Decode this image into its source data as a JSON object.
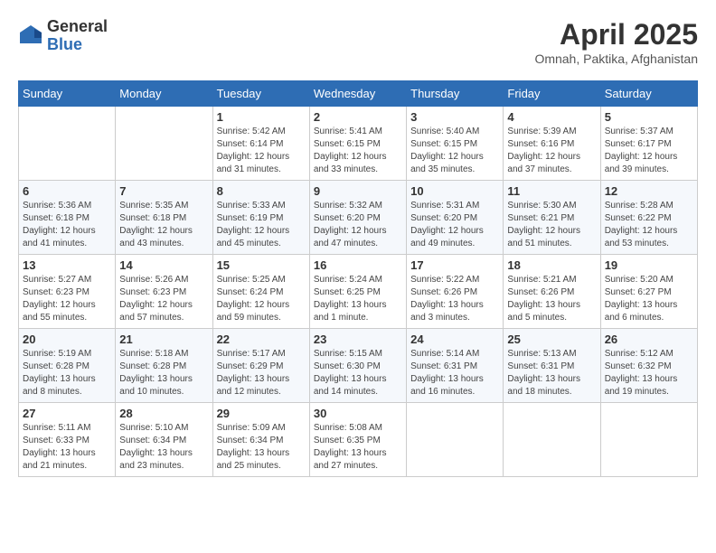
{
  "header": {
    "logo_general": "General",
    "logo_blue": "Blue",
    "title": "April 2025",
    "location": "Omnah, Paktika, Afghanistan"
  },
  "calendar": {
    "days_of_week": [
      "Sunday",
      "Monday",
      "Tuesday",
      "Wednesday",
      "Thursday",
      "Friday",
      "Saturday"
    ],
    "weeks": [
      [
        {
          "day": null,
          "info": ""
        },
        {
          "day": null,
          "info": ""
        },
        {
          "day": "1",
          "info": "Sunrise: 5:42 AM\nSunset: 6:14 PM\nDaylight: 12 hours and 31 minutes."
        },
        {
          "day": "2",
          "info": "Sunrise: 5:41 AM\nSunset: 6:15 PM\nDaylight: 12 hours and 33 minutes."
        },
        {
          "day": "3",
          "info": "Sunrise: 5:40 AM\nSunset: 6:15 PM\nDaylight: 12 hours and 35 minutes."
        },
        {
          "day": "4",
          "info": "Sunrise: 5:39 AM\nSunset: 6:16 PM\nDaylight: 12 hours and 37 minutes."
        },
        {
          "day": "5",
          "info": "Sunrise: 5:37 AM\nSunset: 6:17 PM\nDaylight: 12 hours and 39 minutes."
        }
      ],
      [
        {
          "day": "6",
          "info": "Sunrise: 5:36 AM\nSunset: 6:18 PM\nDaylight: 12 hours and 41 minutes."
        },
        {
          "day": "7",
          "info": "Sunrise: 5:35 AM\nSunset: 6:18 PM\nDaylight: 12 hours and 43 minutes."
        },
        {
          "day": "8",
          "info": "Sunrise: 5:33 AM\nSunset: 6:19 PM\nDaylight: 12 hours and 45 minutes."
        },
        {
          "day": "9",
          "info": "Sunrise: 5:32 AM\nSunset: 6:20 PM\nDaylight: 12 hours and 47 minutes."
        },
        {
          "day": "10",
          "info": "Sunrise: 5:31 AM\nSunset: 6:20 PM\nDaylight: 12 hours and 49 minutes."
        },
        {
          "day": "11",
          "info": "Sunrise: 5:30 AM\nSunset: 6:21 PM\nDaylight: 12 hours and 51 minutes."
        },
        {
          "day": "12",
          "info": "Sunrise: 5:28 AM\nSunset: 6:22 PM\nDaylight: 12 hours and 53 minutes."
        }
      ],
      [
        {
          "day": "13",
          "info": "Sunrise: 5:27 AM\nSunset: 6:23 PM\nDaylight: 12 hours and 55 minutes."
        },
        {
          "day": "14",
          "info": "Sunrise: 5:26 AM\nSunset: 6:23 PM\nDaylight: 12 hours and 57 minutes."
        },
        {
          "day": "15",
          "info": "Sunrise: 5:25 AM\nSunset: 6:24 PM\nDaylight: 12 hours and 59 minutes."
        },
        {
          "day": "16",
          "info": "Sunrise: 5:24 AM\nSunset: 6:25 PM\nDaylight: 13 hours and 1 minute."
        },
        {
          "day": "17",
          "info": "Sunrise: 5:22 AM\nSunset: 6:26 PM\nDaylight: 13 hours and 3 minutes."
        },
        {
          "day": "18",
          "info": "Sunrise: 5:21 AM\nSunset: 6:26 PM\nDaylight: 13 hours and 5 minutes."
        },
        {
          "day": "19",
          "info": "Sunrise: 5:20 AM\nSunset: 6:27 PM\nDaylight: 13 hours and 6 minutes."
        }
      ],
      [
        {
          "day": "20",
          "info": "Sunrise: 5:19 AM\nSunset: 6:28 PM\nDaylight: 13 hours and 8 minutes."
        },
        {
          "day": "21",
          "info": "Sunrise: 5:18 AM\nSunset: 6:28 PM\nDaylight: 13 hours and 10 minutes."
        },
        {
          "day": "22",
          "info": "Sunrise: 5:17 AM\nSunset: 6:29 PM\nDaylight: 13 hours and 12 minutes."
        },
        {
          "day": "23",
          "info": "Sunrise: 5:15 AM\nSunset: 6:30 PM\nDaylight: 13 hours and 14 minutes."
        },
        {
          "day": "24",
          "info": "Sunrise: 5:14 AM\nSunset: 6:31 PM\nDaylight: 13 hours and 16 minutes."
        },
        {
          "day": "25",
          "info": "Sunrise: 5:13 AM\nSunset: 6:31 PM\nDaylight: 13 hours and 18 minutes."
        },
        {
          "day": "26",
          "info": "Sunrise: 5:12 AM\nSunset: 6:32 PM\nDaylight: 13 hours and 19 minutes."
        }
      ],
      [
        {
          "day": "27",
          "info": "Sunrise: 5:11 AM\nSunset: 6:33 PM\nDaylight: 13 hours and 21 minutes."
        },
        {
          "day": "28",
          "info": "Sunrise: 5:10 AM\nSunset: 6:34 PM\nDaylight: 13 hours and 23 minutes."
        },
        {
          "day": "29",
          "info": "Sunrise: 5:09 AM\nSunset: 6:34 PM\nDaylight: 13 hours and 25 minutes."
        },
        {
          "day": "30",
          "info": "Sunrise: 5:08 AM\nSunset: 6:35 PM\nDaylight: 13 hours and 27 minutes."
        },
        {
          "day": null,
          "info": ""
        },
        {
          "day": null,
          "info": ""
        },
        {
          "day": null,
          "info": ""
        }
      ]
    ]
  }
}
